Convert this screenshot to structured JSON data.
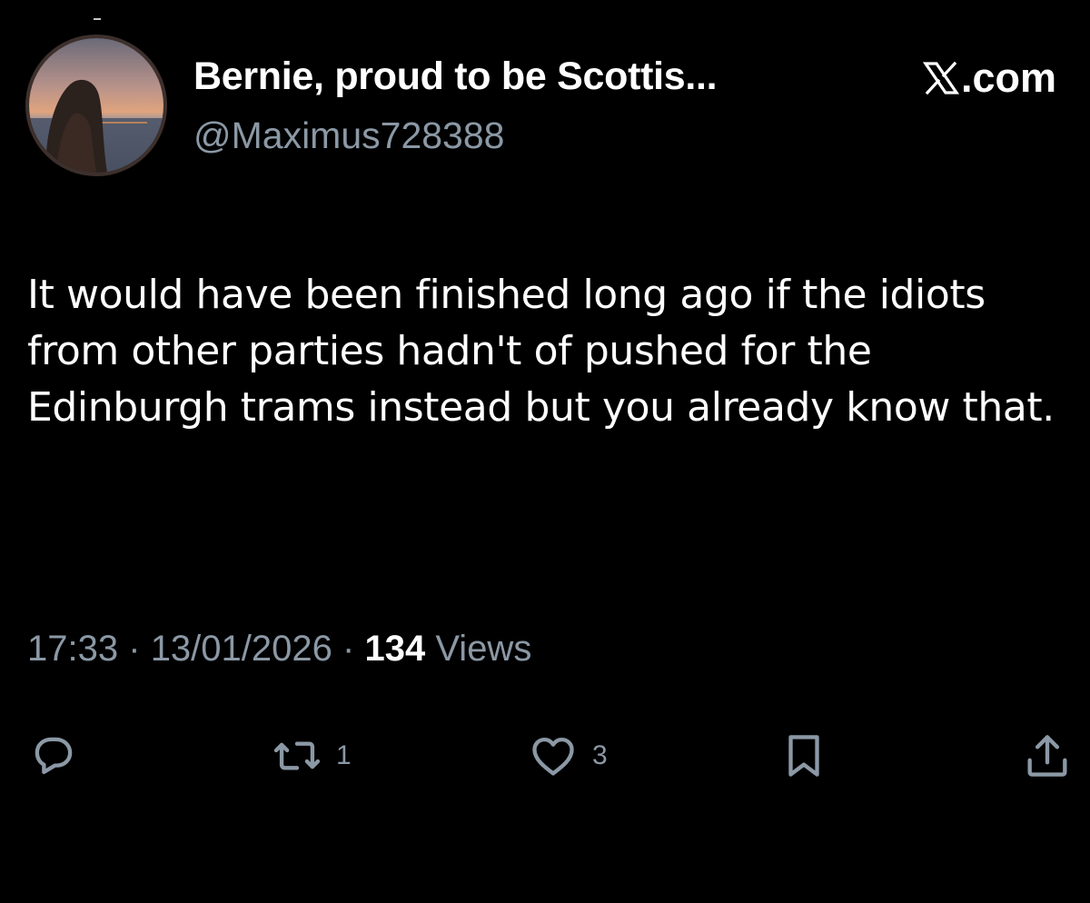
{
  "tweet": {
    "display_name": "Bernie, proud to be Scottis...",
    "handle": "@Maximus728388",
    "brand_label": ".com",
    "text": "It would have been finished long ago if the idiots from other parties hadn't of pushed for the Edinburgh trams instead but you already know that.",
    "time": "17:33",
    "date": "13/01/2026",
    "separator": "·",
    "views_count": "134",
    "views_label": "Views"
  },
  "actions": {
    "reply_icon": "reply-icon",
    "retweet_icon": "retweet-icon",
    "retweet_count": "1",
    "like_icon": "heart-icon",
    "like_count": "3",
    "bookmark_icon": "bookmark-icon",
    "share_icon": "share-icon"
  },
  "colors": {
    "background": "#000000",
    "text_primary": "#ffffff",
    "text_secondary": "#8b98a5"
  }
}
